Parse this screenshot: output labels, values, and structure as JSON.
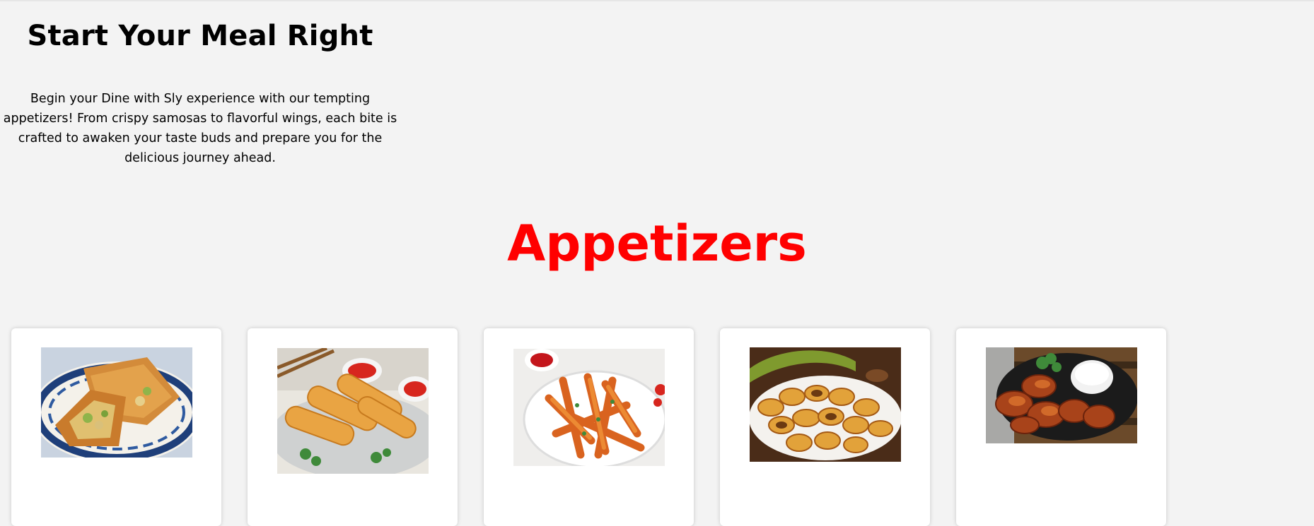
{
  "intro": {
    "title": "Start Your Meal Right",
    "text": "Begin your Dine with Sly experience with our tempting appetizers! From crispy samosas to flavorful wings, each bite is crafted to awaken your taste buds and prepare you for the delicious journey ahead."
  },
  "section": {
    "title": "Appetizers"
  },
  "cards": [
    {
      "image": "samosa-photo"
    },
    {
      "image": "spring-rolls-photo"
    },
    {
      "image": "sweet-potato-fries-photo"
    },
    {
      "image": "fried-plantains-photo"
    },
    {
      "image": "chicken-wings-photo"
    }
  ],
  "colors": {
    "background": "#f3f3f3",
    "section_title": "#ff0000",
    "card": "#ffffff"
  }
}
